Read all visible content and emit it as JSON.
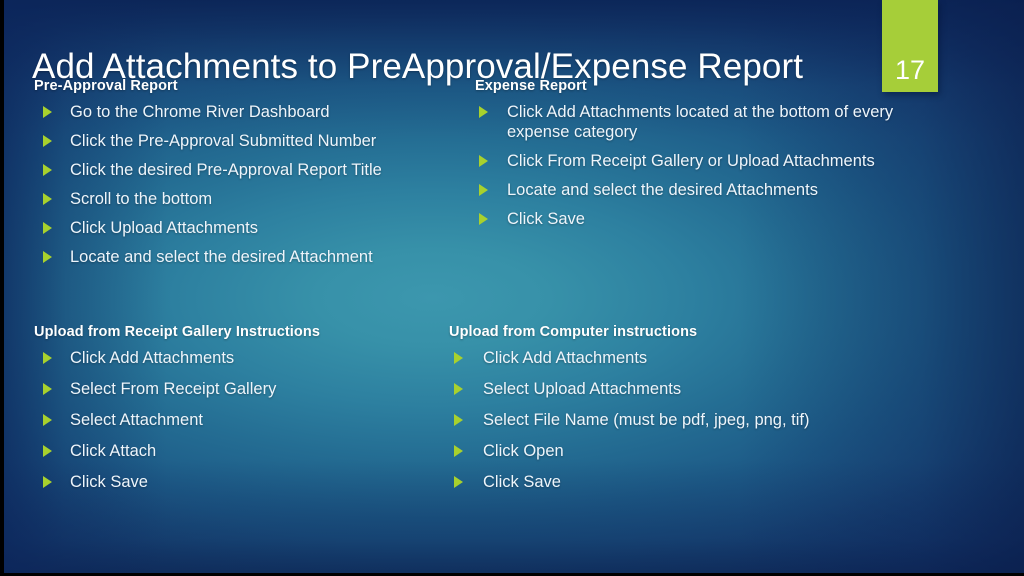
{
  "slide": {
    "title": "Add Attachments to PreApproval/Expense Report",
    "number": "17",
    "accent_green": "#a6ce39",
    "bullet_green": "#a8d12d",
    "background_dark": "#13306d",
    "background_teal": "#3c97ae",
    "text_color": "#eef5fb",
    "frame_color": "#000000"
  },
  "columns": {
    "preapproval": {
      "heading": "Pre-Approval Report",
      "bullets": [
        "Go to the Chrome River Dashboard",
        "Click the Pre-Approval Submitted Number",
        "Click the desired Pre-Approval Report Title",
        "Scroll to the bottom",
        "Click Upload Attachments",
        "Locate and select the desired Attachment"
      ]
    },
    "expense": {
      "heading": "Expense Report",
      "bullets": [
        "Click Add Attachments located at the bottom of every expense category",
        "Click From Receipt Gallery or Upload Attachments",
        "Locate and select the desired Attachments",
        "Click Save"
      ]
    },
    "receipt_gallery": {
      "heading": "Upload from Receipt Gallery Instructions",
      "bullets": [
        "Click Add Attachments",
        "Select From Receipt Gallery",
        "Select Attachment",
        "Click Attach",
        "Click Save"
      ]
    },
    "computer": {
      "heading": "Upload from Computer instructions",
      "bullets": [
        "Click Add Attachments",
        "Select Upload Attachments",
        "Select File Name (must be pdf, jpeg, png, tif)",
        "Click Open",
        "Click Save"
      ]
    }
  }
}
